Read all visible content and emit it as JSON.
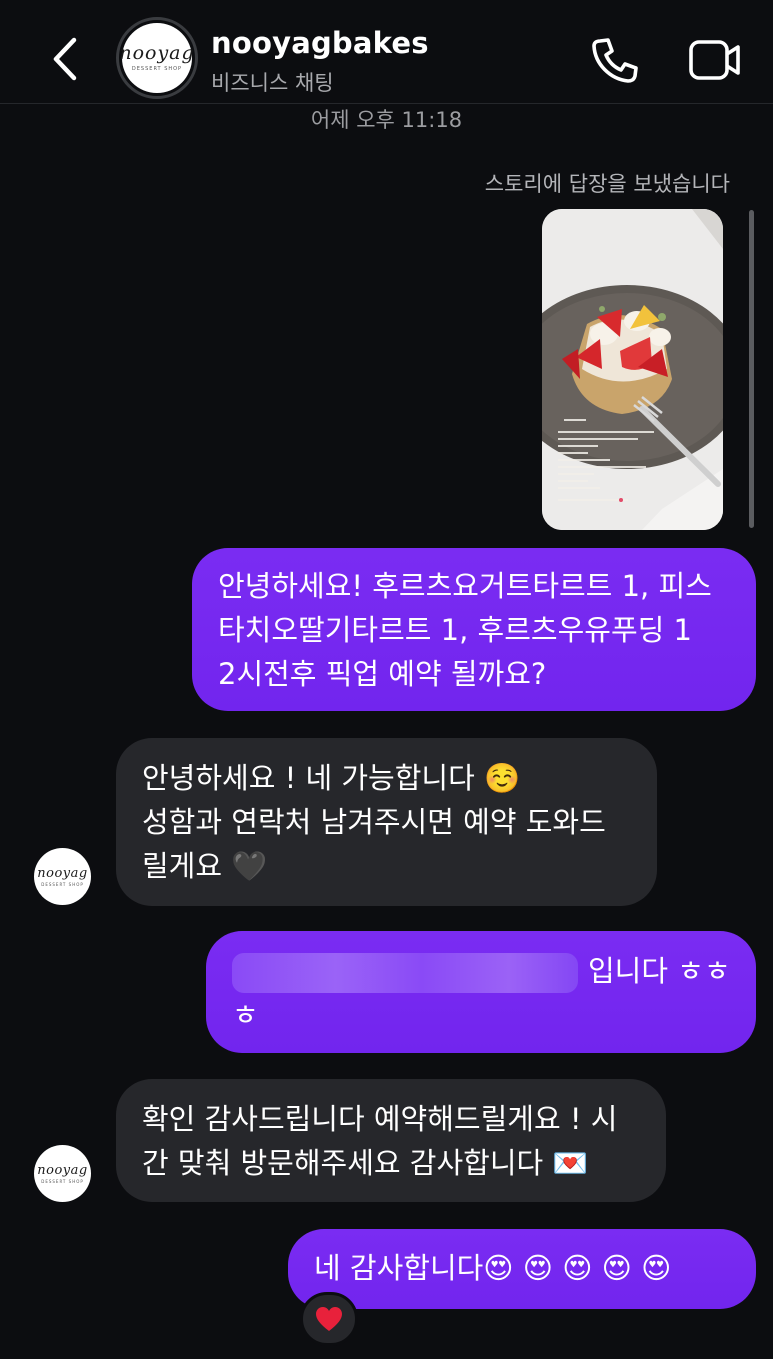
{
  "header": {
    "name": "nooyagbakes",
    "subtitle": "비즈니스 채팅",
    "avatar_logo": "nooyag",
    "avatar_logo_sub": "DESSERT SHOP"
  },
  "timestamp": "어제 오후 11:18",
  "story_reply_caption": "스토리에 답장을 보냈습니다",
  "messages": [
    {
      "direction": "out",
      "lines": [
        "안녕하세요! 후르츠요거트타르트 1, 피스",
        "타치오딸기타르트 1, 후르츠우유푸딩 1",
        "2시전후 픽업 예약 될까요?"
      ]
    },
    {
      "direction": "in",
      "lines": [
        "안녕하세요 ! 네 가능합니다 ☺️",
        "성함과 연락처 남겨주시면 예약 도와드",
        "릴게요 🖤"
      ]
    },
    {
      "direction": "out",
      "text_after_blur": "입니다 ㅎㅎ",
      "line2": "ㅎ"
    },
    {
      "direction": "in",
      "lines": [
        "확인 감사드립니다 예약해드릴게요 ! 시",
        "간 맞춰 방문해주세요 감사합니다 💌"
      ]
    },
    {
      "direction": "out",
      "lines": [
        "네 감사합니다😍 😍 😍 😍 😍"
      ]
    }
  ],
  "reaction": "❤️",
  "colors": {
    "background": "#0c0d10",
    "outgoing_bubble": "#7a2cf2",
    "incoming_bubble": "#26272b",
    "secondary_text": "#9c9da1"
  },
  "icons": [
    "back-chevron-icon",
    "phone-icon",
    "video-camera-icon"
  ]
}
